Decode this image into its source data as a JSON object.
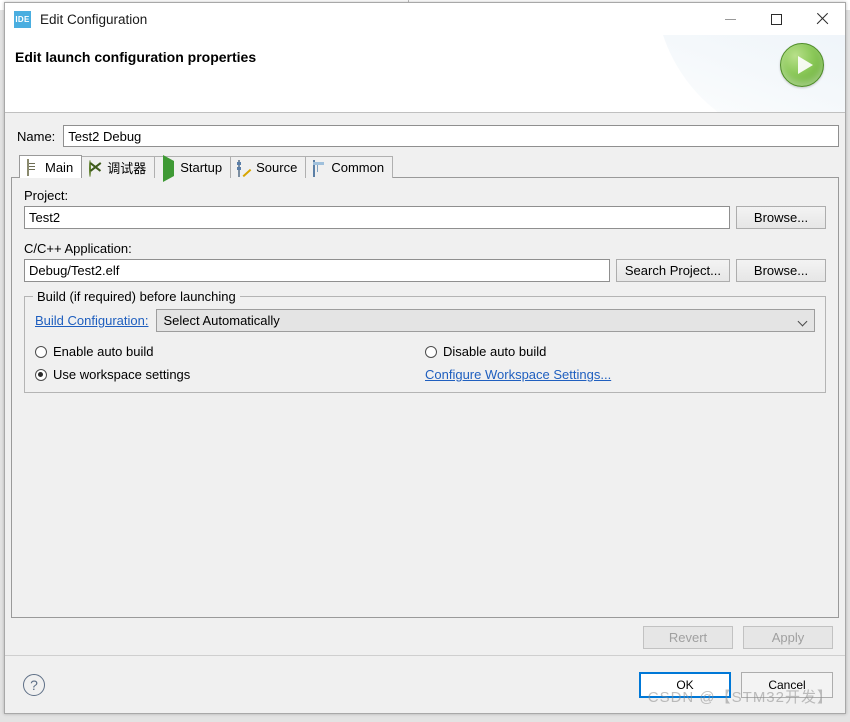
{
  "window": {
    "app_icon_text": "IDE",
    "title": "Edit Configuration",
    "minimize_label": "Minimize",
    "maximize_label": "Maximize",
    "close_label": "Close"
  },
  "header": {
    "title": "Edit launch configuration properties",
    "run_icon": "run-play-icon"
  },
  "name_field": {
    "label": "Name:",
    "value": "Test2 Debug"
  },
  "tabs": [
    {
      "label": "Main",
      "icon": "document-icon",
      "active": true
    },
    {
      "label": "调试器",
      "icon": "debugger-bug-icon",
      "active": false
    },
    {
      "label": "Startup",
      "icon": "play-icon",
      "active": false
    },
    {
      "label": "Source",
      "icon": "source-edit-icon",
      "active": false
    },
    {
      "label": "Common",
      "icon": "table-icon",
      "active": false
    }
  ],
  "main_tab": {
    "project": {
      "label": "Project:",
      "value": "Test2",
      "browse_label": "Browse..."
    },
    "application": {
      "label": "C/C++ Application:",
      "value": "Debug/Test2.elf",
      "search_project_label": "Search Project...",
      "browse_label": "Browse..."
    },
    "build_group": {
      "title": "Build (if required) before launching",
      "build_configuration_link": "Build Configuration:",
      "build_configuration_value": "Select Automatically",
      "radios": [
        {
          "label": "Enable auto build",
          "checked": false
        },
        {
          "label": "Disable auto build",
          "checked": false
        },
        {
          "label": "Use workspace settings",
          "checked": true
        }
      ],
      "configure_workspace_link": "Configure Workspace Settings..."
    }
  },
  "actions": {
    "revert_label": "Revert",
    "revert_enabled": false,
    "apply_label": "Apply",
    "apply_enabled": false
  },
  "footer": {
    "help_glyph": "?",
    "ok_label": "OK",
    "cancel_label": "Cancel"
  },
  "watermark": "CSDN @【STM32开发】",
  "colors": {
    "accent_blue": "#0078d7",
    "link_blue": "#1f5fbf",
    "window_bg": "#f0f0f0",
    "title_bg": "#ffffff",
    "run_green": "#5da32e",
    "ide_icon_blue": "#4aaee0"
  }
}
